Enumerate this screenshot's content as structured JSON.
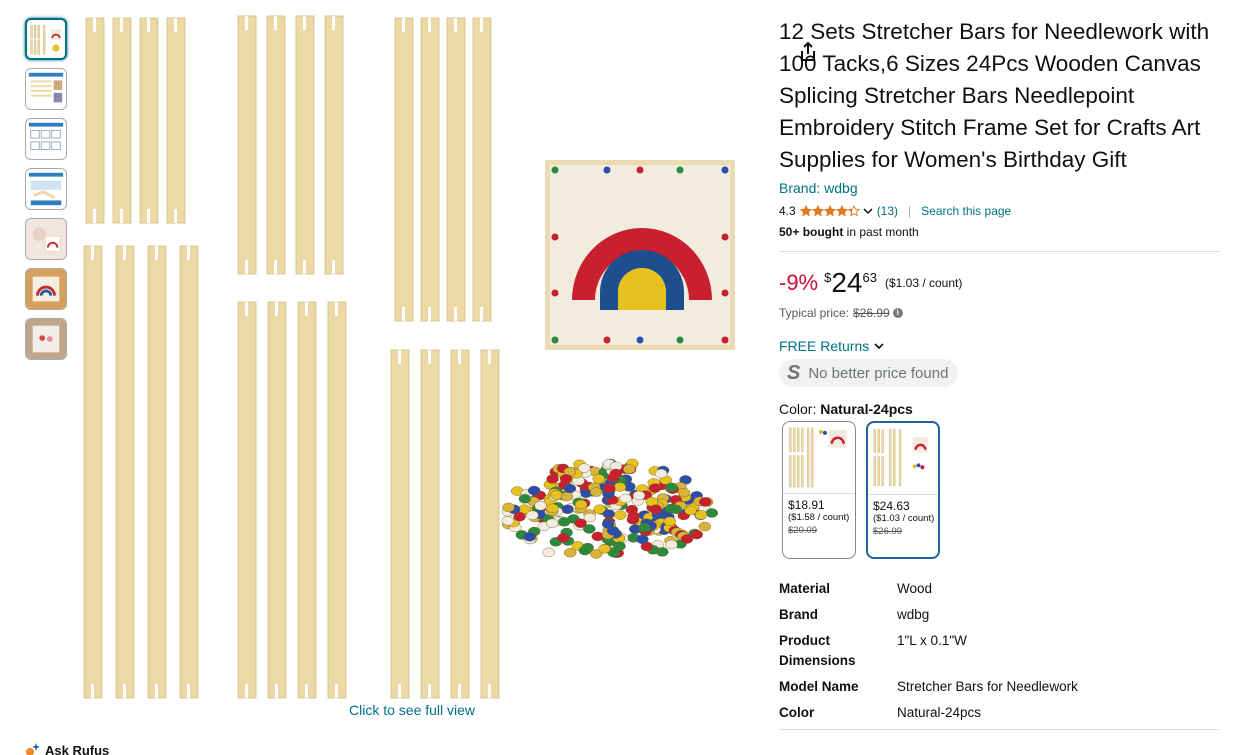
{
  "gallery": {
    "thumbnails": [
      "thumb-1",
      "thumb-2",
      "thumb-3",
      "thumb-4",
      "thumb-5",
      "thumb-6",
      "thumb-7"
    ],
    "selected_index": 0,
    "full_view_label": "Click to see full view",
    "share_icon": "share-icon"
  },
  "rufus": {
    "label": "Ask Rufus"
  },
  "product": {
    "title": "12 Sets Stretcher Bars for Needlework with 100 Tacks,6 Sizes 24Pcs Wooden Canvas Splicing Stretcher Bars Needlepoint Embroidery Stitch Frame Set for Crafts Art Supplies for Women's Birthday Gift",
    "brand_link": "Brand: wdbg",
    "rating": "4.3",
    "rating_value": 4.3,
    "rating_count": "(13)",
    "search_page": "Search this page",
    "bought_bold": "50+ bought",
    "bought_rest": " in past month"
  },
  "price": {
    "discount": "-9%",
    "currency": "$",
    "whole": "24",
    "fraction": "63",
    "per_unit": "($1.03 / count)",
    "typical_label": "Typical price:",
    "typical_value": "$26.99",
    "info_icon": "i"
  },
  "returns": {
    "label": "FREE Returns"
  },
  "no_better_price": {
    "logo": "S",
    "label": "No better price found"
  },
  "color": {
    "label": "Color: ",
    "selected": "Natural-24pcs",
    "options": [
      {
        "price": "$18.91",
        "unit": "($1.58 / count)",
        "old": "$20.09"
      },
      {
        "price": "$24.63",
        "unit": "($1.03 / count)",
        "old": "$26.99"
      }
    ]
  },
  "specs": [
    {
      "label": "Material",
      "value": "Wood"
    },
    {
      "label": "Brand",
      "value": "wdbg"
    },
    {
      "label": "Product Dimensions",
      "value": "1\"L x 0.1\"W"
    },
    {
      "label": "Model Name",
      "value": "Stretcher Bars for Needlework"
    },
    {
      "label": "Color",
      "value": "Natural-24pcs"
    }
  ],
  "colors": {
    "link": "#007185",
    "discount": "#cc0c39",
    "star": "#de7921",
    "selected_border": "#2162a1",
    "wood": "#ecd9a6"
  }
}
